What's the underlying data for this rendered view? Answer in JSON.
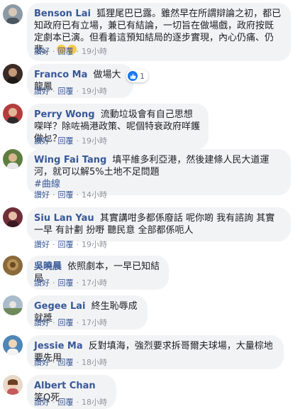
{
  "actions": {
    "like": "讚好",
    "reply": "回覆"
  },
  "comments": [
    {
      "author": "Benson Lai",
      "text": "狐狸尾巴已露。雖然早在所謂辯論之初，都已知政府已有立場，兼已有結論，一切旨在做場戲，政府按既定劇本已演。但看着這預知結局的逐步實現，內心仍痛、仍悲。",
      "time": "19小時",
      "avatar_color": "#7a8a97"
    },
    {
      "author": "Franco Ma",
      "text": "做場大龍鳳",
      "time": "19小時",
      "reaction_count": "1",
      "avatar_color": "#3b2a25"
    },
    {
      "author": "Perry Wong",
      "text": "流動垃圾會有自己思想㗎咩？除咗禍港政策、呢個特衰政府咩鑊做乜？",
      "time": "19小時",
      "avatar_color": "#a33a3a"
    },
    {
      "author": "Wing Fai Tang",
      "text": "填平維多利亞港，然後建條人民大道運河，就可以解5%土地不足問題",
      "hashtag": "#曲線",
      "time": "14小時",
      "avatar_color": "#6b8a4a"
    },
    {
      "author": "Siu Lan Yau",
      "text": "其實講咁多都係廢話 呢你啲 我有諮詢 其實一早 有計劃 扮嘢 聽民意 全部都係呃人",
      "time": "19小時",
      "avatar_color": "#7a3540"
    },
    {
      "author": "吳曉晨",
      "text": "依照劇本，一早已知結局",
      "time": "17小時",
      "avatar_color": "#8a6a3a"
    },
    {
      "author": "Gegee Lai",
      "text": "終生恥辱成就獎",
      "time": "17小時",
      "avatar_color": "#8aa0b0"
    },
    {
      "author": "Jessie Ma",
      "text": "反對填海，強烈要求拆哥爾夫球場，大量棕地要先用",
      "time": "18小時",
      "avatar_color": "#5a8ab8"
    },
    {
      "author": "Albert Chan",
      "text": "笑Q死",
      "time": "18小時",
      "avatar_color": "#c9a58a"
    }
  ]
}
